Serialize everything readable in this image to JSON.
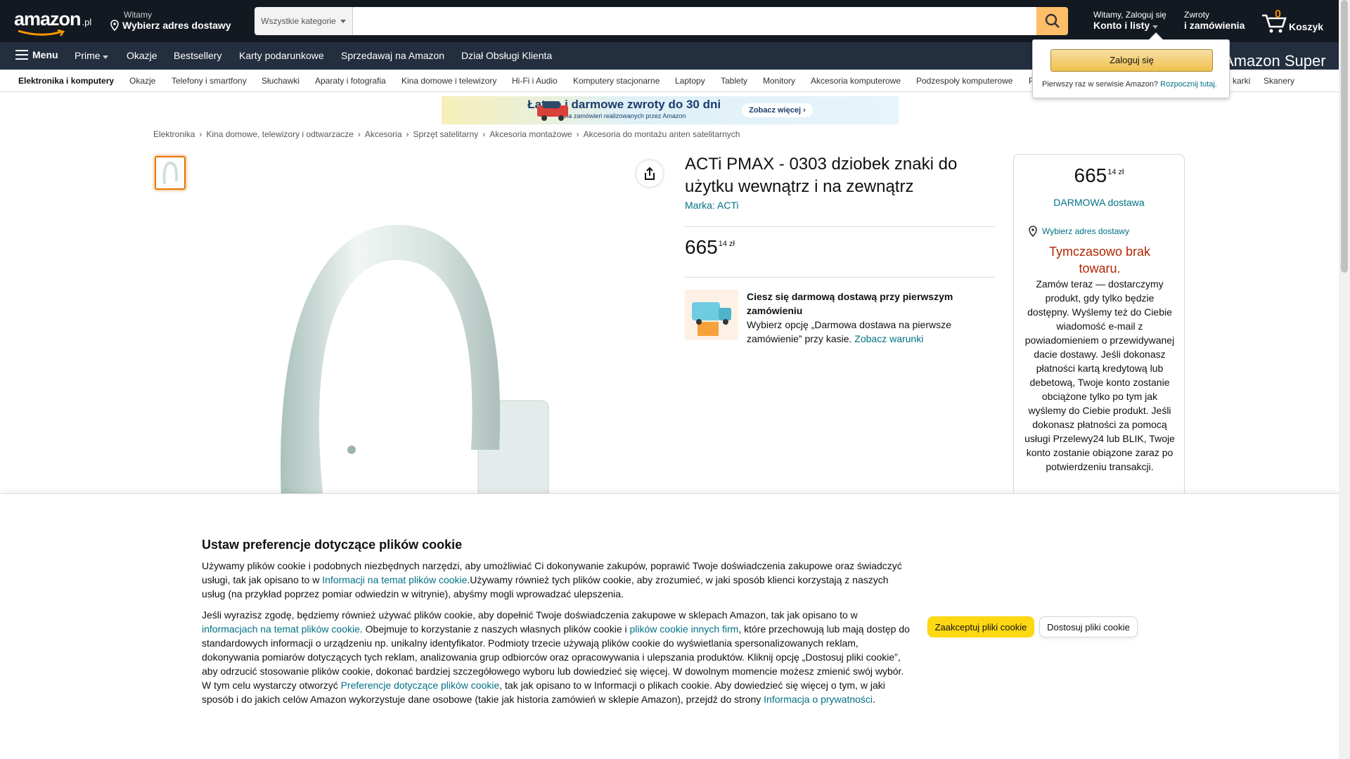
{
  "header": {
    "logo_text": "amazon",
    "logo_tld": ".pl",
    "deliver_line1": "Witamy",
    "deliver_line2": "Wybierz adres dostawy",
    "search_category": "Wszystkie kategorie",
    "search_placeholder": "",
    "account_line1": "Witamy, Zaloguj się",
    "account_line2": "Konto i listy",
    "returns_line1": "Zwroty",
    "returns_line2": "i zamówienia",
    "cart_count": "0",
    "cart_label": "Koszyk"
  },
  "navmain": {
    "menu": "Menu",
    "items": [
      "Prime",
      "Okazje",
      "Bestsellery",
      "Karty podarunkowe",
      "Sprzedawaj na Amazon",
      "Dział Obsługi Klienta"
    ],
    "super_banner": "Amazon Super"
  },
  "subnav": {
    "items": [
      "Elektronika i komputery",
      "Okazje",
      "Telefony i smartfony",
      "Słuchawki",
      "Aparaty i fotografia",
      "Kina domowe i telewizory",
      "Hi-Fi i Audio",
      "Komputery stacjonarne",
      "Laptopy",
      "Tablety",
      "Monitory",
      "Akcesoria komputerowe",
      "Podzespoły komputerowe",
      "P",
      "karki",
      "Skanery"
    ]
  },
  "promo": {
    "title": "Łatwe i darmowe zwroty do 30 dni",
    "subtitle": "Dla zamówień realizowanych przez Amazon",
    "cta": "Zobacz więcej ›"
  },
  "breadcrumb": [
    "Elektronika",
    "Kina domowe, telewizory i odtwarzacze",
    "Akcesoria",
    "Sprzęt satelitarny",
    "Akcesoria montażowe",
    "Akcesoria do montażu anten satelitarnych"
  ],
  "product": {
    "title": "ACTi PMAX - 0303 dziobek znaki do użytku wewnątrz i na zewnątrz",
    "brand": "Marka: ACTi",
    "price_whole": "665",
    "price_fraction": "14 zł",
    "free_ship_title": "Ciesz się darmową dostawą przy pierwszym zamówieniu",
    "free_ship_text": "Wybierz opcję „Darmowa dostawa na pierwsze zamówienie” przy kasie.",
    "free_ship_link": "Zobacz warunki"
  },
  "buybox": {
    "price_whole": "665",
    "price_fraction": "14 zł",
    "shipping": "DARMOWA dostawa",
    "address_link": "Wybierz adres dostawy",
    "out_of_stock": "Tymczasowo brak towaru.",
    "description": "Zamów teraz — dostarczymy produkt, gdy tylko będzie dostępny. Wyślemy też do Ciebie wiadomość e-mail z powiadomieniem o przewidywanej dacie dostawy. Jeśli dokonasz płatności kartą kredytową lub debetową, Twoje konto zostanie obciążone tylko po tym jak wyślemy do Ciebie produkt. Jeśli dokonasz płatności za pomocą usługi Przelewy24 lub BLIK, Twoje konto zostanie obiązone zaraz po potwierdzeniu transakcji."
  },
  "signin_popover": {
    "button": "Zaloguj się",
    "new_customer": "Pierwszy raz w serwisie Amazon?",
    "start_link": "Rozpocznij tutaj."
  },
  "cookie": {
    "title": "Ustaw preferencje dotyczące plików cookie",
    "p1_a": "Używamy plików cookie i podobnych niezbędnych narzędzi, aby umożliwiać Ci dokonywanie zakupów, poprawić Twoje doświadczenia zakupowe oraz świadczyć usługi, tak jak opisano to w ",
    "p1_link": "Informacji na temat plików cookie",
    "p1_b": ".Używamy również tych plików cookie, aby zrozumieć, w jaki sposób klienci korzystają z naszych usług (na przykład poprzez pomiar odwiedzin w witrynie), abyśmy mogli wprowadzać ulepszenia.",
    "p2_a": "Jeśli wyrazisz zgodę, będziemy również używać plików cookie, aby dopełnić Twoje doświadczenia zakupowe w sklepach Amazon, tak jak opisano to w ",
    "p2_link1": "informacjach na temat plików cookie",
    "p2_b": ". Obejmuje to korzystanie z naszych własnych plików cookie i ",
    "p2_link2": "plików cookie innych firm",
    "p2_c": ", które przechowują lub mają dostęp do standardowych informacji o urządzeniu np. unikalny identyfikator. Podmioty trzecie używają plików cookie do wyświetlania spersonalizowanych reklam, dokonywania pomiarów dotyczących tych reklam, analizowania grup odbiorców oraz opracowywania i ulepszania produktów. Kliknij opcję „Dostosuj pliki cookie”, aby odrzucić stosowanie plików cookie, dokonać bardziej szczegółowego wyboru lub dowiedzieć się więcej. W dowolnym momencie możesz zmienić swój wybór. W tym celu wystarczy otworzyć ",
    "p2_link3": "Preferencje dotyczące plików cookie",
    "p2_d": ", tak jak opisano to w Informacji o plikach cookie. Aby dowiedzieć się więcej o tym, w jaki sposób i do jakich celów Amazon wykorzystuje dane osobowe (takie jak historia zamówień w sklepie Amazon), przejdź do strony ",
    "p2_link4": "Informacja o prywatności",
    "p2_e": ".",
    "accept": "Zaakceptuj pliki cookie",
    "customize": "Dostosuj pliki cookie"
  },
  "colors": {
    "nav_dark": "#131921",
    "nav_secondary": "#232f3e",
    "search_button": "#febd69",
    "accept_button": "#ffd814",
    "link": "#007185",
    "out_of_stock": "#b12704"
  }
}
